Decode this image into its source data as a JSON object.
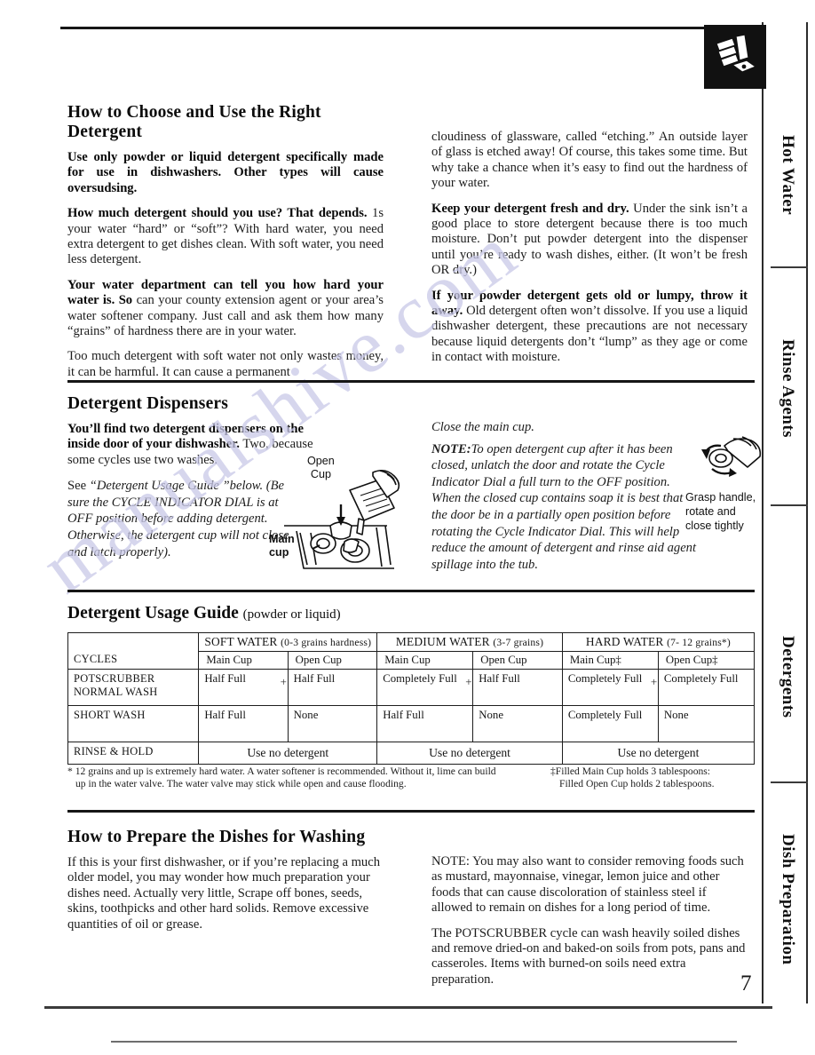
{
  "page": {
    "number": "7",
    "watermark": "manualshive.com"
  },
  "side_tabs": [
    {
      "label": "Hot Water"
    },
    {
      "label": "Rinse Agents"
    },
    {
      "label": "Detergents"
    },
    {
      "label": "Dish Preparation"
    }
  ],
  "icons": {
    "hand_press": "hand-pressing-button-icon"
  },
  "section_detergent": {
    "title": "How to Choose and Use the Right Detergent",
    "left": [
      {
        "lead": "Use only powder or liquid detergent specifically made for use in dishwashers. Other types will cause oversudsing.",
        "rest": ""
      },
      {
        "lead": "How much detergent should you use? That depends.",
        "rest": " 1s your water “hard” or “soft”? With hard water, you need extra detergent to get dishes clean. With soft water, you need less detergent."
      },
      {
        "lead": "Your water department can tell you how hard your water is. So",
        "rest": " can your county extension agent or your area’s water softener company. Just call and ask them how many “grains” of hardness there are in your water."
      },
      {
        "lead": "",
        "rest": "Too much detergent with soft water not only wastes money, it can be harmful. It can cause a permanent"
      }
    ],
    "right": [
      {
        "lead": "",
        "rest": "cloudiness of glassware, called “etching.” An outside layer of glass is etched away! Of course, this takes some time. But why take a chance when it’s easy to find out the hardness of your water."
      },
      {
        "lead": "Keep your detergent fresh and dry.",
        "rest": " Under the sink isn’t a good place to store detergent because there is too much moisture. Don’t put powder detergent into the dispenser until you’re ready to wash dishes, either. (It won’t be fresh OR dry.)"
      },
      {
        "lead": "If your powder detergent gets old or lumpy, throw it away.",
        "rest": " Old detergent often won’t dissolve. If you use a liquid dishwasher detergent, these precautions are not necessary because liquid detergents don’t “lump” as they age or come in contact with moisture."
      }
    ]
  },
  "section_dispensers": {
    "title": "Detergent Dispensers",
    "intro_bold": "You’ll find two detergent dispensers on the inside door of your dishwasher.",
    "intro_rest": " Two, because some cycles use two washes.",
    "italic_note_prefix": "See",
    "italic_note": "“Detergent Usage Guide ”below. (Be sure the CYCLE INDICATOR DIAL is at OFF position before adding detergent. Otherwise, the detergent cup will not close and latch properly).",
    "diagram_labels": {
      "open_cup": "Open\nCup",
      "main_cup": "Main\ncup"
    },
    "right_lead": "Close the main cup.",
    "right_note_label": "NOTE:",
    "right_note_body": "To open detergent cup after it has been closed, unlatch the door and rotate the Cycle Indicator Dial a full turn to the OFF position. When the closed cup contains soap it is best that the door be in a partially open position before rotating the Cycle Indicator Dial. This will help reduce the amount of detergent and rinse aid agent spillage into the tub.",
    "grasp_caption": "Grasp handle,\nrotate and\nclose tightly"
  },
  "usage_guide": {
    "title": "Detergent Usage Guide",
    "subtitle": "(powder or liquid)",
    "corner_header": "CYCLES",
    "groups": [
      {
        "name": "SOFT WATER",
        "range": "(0-3 grains hardness)"
      },
      {
        "name": "MEDIUM WATER",
        "range": "(3-7 grains)"
      },
      {
        "name": "HARD WATER",
        "range": "(7- 12 grains*)"
      }
    ],
    "cup_headers": [
      "Main Cup",
      "Open Cup",
      "Main Cup",
      "Open Cup",
      "Main Cup‡",
      "Open Cup‡"
    ],
    "plus_sign": "+",
    "rows": [
      {
        "cycle": "POTSCRUBBER NORMAL WASH",
        "values": [
          "Half Full",
          "Half Full",
          "Completely Full",
          "Half Full",
          "Completely Full",
          "Completely Full"
        ]
      },
      {
        "cycle": "SHORT WASH",
        "values": [
          "Half Full",
          "None",
          "Half Full",
          "None",
          "Completely Full",
          "None"
        ]
      }
    ],
    "rinse_row": {
      "cycle": "RINSE & HOLD",
      "value": "Use no detergent"
    },
    "footnote_left": "* 12 grains and up is extremely hard water. A water softener is recommended. Without it, lime can build up in the water valve. The water valve may stick while open and cause flooding.",
    "footnote_right_line1": "‡Filled Main Cup holds 3 tablespoons:",
    "footnote_right_line2": "Filled Open Cup holds 2 tablespoons."
  },
  "section_prepare": {
    "title": "How to Prepare the Dishes for Washing",
    "left_paragraph": "If this is your first dishwasher, or if you’re replacing a much older model, you may wonder how much preparation your dishes need. Actually very little, Scrape off bones, seeds, skins, toothpicks and other hard solids. Remove excessive quantities of oil or grease.",
    "right_paragraph_1": "NOTE: You may also want to consider removing foods such as mustard, mayonnaise, vinegar, lemon juice and other foods that can cause discoloration of stainless steel if allowed to remain on dishes for a long period of time.",
    "right_paragraph_2": "The POTSCRUBBER cycle can wash heavily soiled dishes and remove dried-on and baked-on soils from pots, pans and casseroles. Items with burned-on soils need extra preparation."
  }
}
